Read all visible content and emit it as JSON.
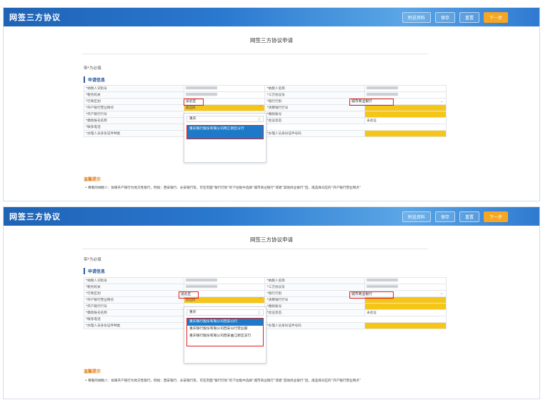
{
  "app_title": "网签三方协议",
  "header_buttons": {
    "attach": "附送资料",
    "save": "保存",
    "reset": "重置",
    "next": "下一步"
  },
  "page_title": "网签三方协议申请",
  "required_note_prefix": "带",
  "required_note_star": "*",
  "required_note_suffix": "为必填",
  "section_title": "申请信息",
  "fields": {
    "taxpayer_id": "*纳税人识别号",
    "taxpayer_name": "*纳税人名称",
    "tax_authority": "*税务机关",
    "tripartite_no": "*三方协议号",
    "region": "*行政区划",
    "bank_category": "*银行行别",
    "open_bank": "*开户银行营业网点",
    "settle_bank_no": "*清算银行行号",
    "open_bank_no": "*开户银行行号",
    "pay_account": "*缴款账号",
    "pay_account_name": "*缴款账号名称",
    "verify_status": "*验证状态",
    "contact_phone": "*联系电话",
    "agent_id_type": "*办理人员身份证件种类",
    "agent_id_no": "*办理人员身份证件号码"
  },
  "values": {
    "region": "渝北区",
    "bank_category": "城市商业银行",
    "open_bank_selected": "请选择",
    "verify_status": "未验证"
  },
  "dropdown1": {
    "search": "重庆",
    "options": [
      "重庆银行股份有限公司两江新区分行"
    ]
  },
  "dropdown2": {
    "search": "重庆",
    "options": [
      "重庆银行股份有限公司西安分行",
      "重庆银行股份有限公司西安分行营业部",
      "重庆银行股份有限公司西安曲江新区支行"
    ]
  },
  "tip_title": "温馨提示",
  "tip_text": "• 尊敬的纳税人：如果开户银行为地方性银行，例如：西安银行、长安银行等，可在页面“银行行别”的下拉框中选择“城市商业银行”或者“其他商业银行”后，再选择对应的“开户银行营业网点”",
  "colors": {
    "header": "#2a78cf",
    "accent": "#f5c518",
    "next_button": "#f5a623",
    "highlight": "#e02020",
    "selected_option": "#1e7ac9"
  }
}
